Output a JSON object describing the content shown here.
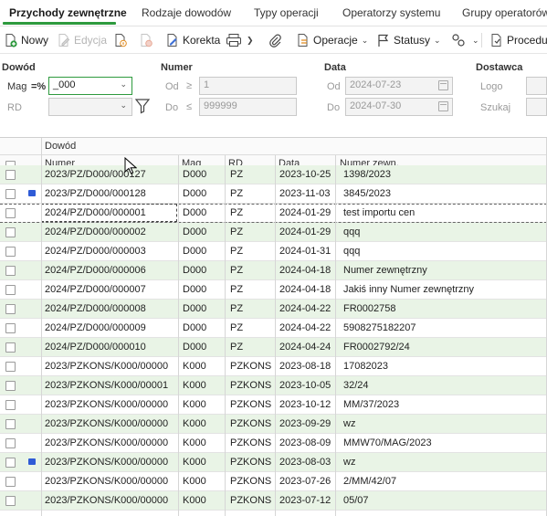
{
  "tabs": [
    {
      "label": "Przychody zewnętrzne",
      "active": true
    },
    {
      "label": "Rodzaje dowodów"
    },
    {
      "label": "Typy operacji"
    },
    {
      "label": "Operatorzy systemu"
    },
    {
      "label": "Grupy operatorów"
    }
  ],
  "toolbar": {
    "new_label": "Nowy",
    "edit_label": "Edycja",
    "korekta_label": "Korekta",
    "operacje_label": "Operacje",
    "statusy_label": "Statusy",
    "procedury_label": "Procedur"
  },
  "filters": {
    "dowod": {
      "heading": "Dowód",
      "mag_label": "Mag",
      "mag_op": "=%",
      "mag_value": "_000",
      "rd_label": "RD",
      "rd_value": ""
    },
    "numer": {
      "heading": "Numer",
      "od_label": "Od",
      "od_op": "≥",
      "od_value": "1",
      "do_label": "Do",
      "do_op": "≤",
      "do_value": "999999"
    },
    "data": {
      "heading": "Data",
      "od_label": "Od",
      "od_value": "2024-07-23",
      "do_label": "Do",
      "do_value": "2024-07-30"
    },
    "dostawca": {
      "heading": "Dostawca",
      "logo_label": "Logo",
      "szukaj_label": "Szukaj"
    }
  },
  "grid": {
    "group_header": "Dowód",
    "columns": [
      "Numer",
      "Mag",
      "RD",
      "Data",
      "Numer zewn."
    ],
    "rows": [
      {
        "numer": "2023/PZ/D000/000127",
        "mag": "D000",
        "rd": "PZ",
        "data": "2023-10-25",
        "zewn": "1398/2023",
        "alt": true,
        "flag": false
      },
      {
        "numer": "2023/PZ/D000/000128",
        "mag": "D000",
        "rd": "PZ",
        "data": "2023-11-03",
        "zewn": "3845/2023",
        "alt": false,
        "flag": true
      },
      {
        "numer": "2024/PZ/D000/000001",
        "mag": "D000",
        "rd": "PZ",
        "data": "2024-01-29",
        "zewn": "test importu cen",
        "alt": false,
        "flag": false,
        "focused": true
      },
      {
        "numer": "2024/PZ/D000/000002",
        "mag": "D000",
        "rd": "PZ",
        "data": "2024-01-29",
        "zewn": "qqq",
        "alt": true,
        "flag": false
      },
      {
        "numer": "2024/PZ/D000/000003",
        "mag": "D000",
        "rd": "PZ",
        "data": "2024-01-31",
        "zewn": "qqq",
        "alt": false,
        "flag": false
      },
      {
        "numer": "2024/PZ/D000/000006",
        "mag": "D000",
        "rd": "PZ",
        "data": "2024-04-18",
        "zewn": "Numer zewnętrzny",
        "alt": true,
        "flag": false
      },
      {
        "numer": "2024/PZ/D000/000007",
        "mag": "D000",
        "rd": "PZ",
        "data": "2024-04-18",
        "zewn": "Jakiś inny Numer zewnętrzny",
        "alt": false,
        "flag": false
      },
      {
        "numer": "2024/PZ/D000/000008",
        "mag": "D000",
        "rd": "PZ",
        "data": "2024-04-22",
        "zewn": "FR0002758",
        "alt": true,
        "flag": false
      },
      {
        "numer": "2024/PZ/D000/000009",
        "mag": "D000",
        "rd": "PZ",
        "data": "2024-04-22",
        "zewn": "5908275182207",
        "alt": false,
        "flag": false
      },
      {
        "numer": "2024/PZ/D000/000010",
        "mag": "D000",
        "rd": "PZ",
        "data": "2024-04-24",
        "zewn": "FR0002792/24",
        "alt": true,
        "flag": false
      },
      {
        "numer": "2023/PZKONS/K000/00000",
        "mag": "K000",
        "rd": "PZKONS",
        "data": "2023-08-18",
        "zewn": "17082023",
        "alt": false,
        "flag": false
      },
      {
        "numer": "2023/PZKONS/K000/00001",
        "mag": "K000",
        "rd": "PZKONS",
        "data": "2023-10-05",
        "zewn": "32/24",
        "alt": true,
        "flag": false
      },
      {
        "numer": "2023/PZKONS/K000/00000",
        "mag": "K000",
        "rd": "PZKONS",
        "data": "2023-10-12",
        "zewn": "MM/37/2023",
        "alt": false,
        "flag": false
      },
      {
        "numer": "2023/PZKONS/K000/00000",
        "mag": "K000",
        "rd": "PZKONS",
        "data": "2023-09-29",
        "zewn": "wz",
        "alt": true,
        "flag": false
      },
      {
        "numer": "2023/PZKONS/K000/00000",
        "mag": "K000",
        "rd": "PZKONS",
        "data": "2023-08-09",
        "zewn": "MMW70/MAG/2023",
        "alt": false,
        "flag": false
      },
      {
        "numer": "2023/PZKONS/K000/00000",
        "mag": "K000",
        "rd": "PZKONS",
        "data": "2023-08-03",
        "zewn": "wz",
        "alt": true,
        "flag": true
      },
      {
        "numer": "2023/PZKONS/K000/00000",
        "mag": "K000",
        "rd": "PZKONS",
        "data": "2023-07-26",
        "zewn": "2/MM/42/07",
        "alt": false,
        "flag": false
      },
      {
        "numer": "2023/PZKONS/K000/00000",
        "mag": "K000",
        "rd": "PZKONS",
        "data": "2023-07-12",
        "zewn": "05/07",
        "alt": true,
        "flag": false
      }
    ]
  },
  "colors": {
    "accent": "#2e9a3e",
    "alt_row": "#e9f4e6",
    "flag": "#2f5bd6"
  }
}
